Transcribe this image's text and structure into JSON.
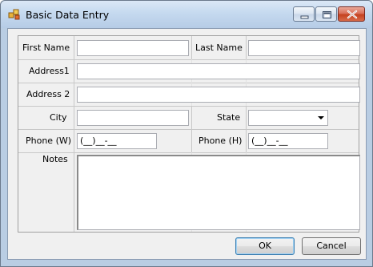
{
  "window": {
    "title": "Basic Data Entry"
  },
  "form": {
    "first_name_label": "First Name",
    "first_name_value": "",
    "last_name_label": "Last Name",
    "last_name_value": "",
    "address1_label": "Address1",
    "address1_value": "",
    "address2_label": "Address 2",
    "address2_value": "",
    "city_label": "City",
    "city_value": "",
    "state_label": "State",
    "state_value": "",
    "phone_w_label": "Phone (W)",
    "phone_w_value": "(__)__-__",
    "phone_h_label": "Phone (H)",
    "phone_h_value": "(__)__-__",
    "notes_label": "Notes",
    "notes_value": ""
  },
  "buttons": {
    "ok_label": "OK",
    "cancel_label": "Cancel"
  },
  "icons": {
    "app": "app-icon",
    "minimize": "minimize-icon",
    "maximize": "maximize-icon",
    "close": "close-icon",
    "dropdown": "chevron-down-icon"
  }
}
